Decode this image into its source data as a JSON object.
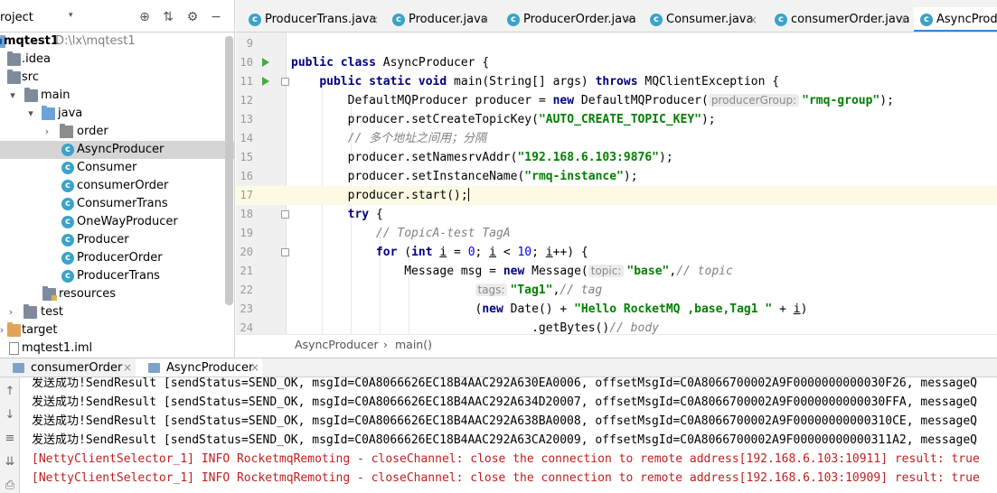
{
  "project": {
    "header_label": "roject",
    "arrow": "▾",
    "icons": [
      "target-icon",
      "collapse-icon",
      "gear-icon",
      "minimize-icon"
    ],
    "tree": [
      {
        "label": "mqtest1",
        "sub": "D:\\lx\\mqtest1",
        "icon": "module-icon",
        "arrow": "▾"
      },
      {
        "label": ".idea",
        "icon": "folder-icon",
        "arrow": ""
      },
      {
        "label": "src",
        "icon": "folder-icon",
        "arrow": ""
      },
      {
        "label": "main",
        "icon": "folder-icon",
        "arrow": "▾"
      },
      {
        "label": "java",
        "icon": "folder-icon",
        "arrow": "▾"
      },
      {
        "label": "order",
        "icon": "package-icon",
        "arrow": "›"
      },
      {
        "label": "AsyncProducer",
        "icon": "class-icon",
        "arrow": ""
      },
      {
        "label": "Consumer",
        "icon": "class-icon",
        "arrow": ""
      },
      {
        "label": "consumerOrder",
        "icon": "class-icon",
        "arrow": ""
      },
      {
        "label": "ConsumerTrans",
        "icon": "class-icon",
        "arrow": ""
      },
      {
        "label": "OneWayProducer",
        "icon": "class-icon",
        "arrow": ""
      },
      {
        "label": "Producer",
        "icon": "class-icon",
        "arrow": ""
      },
      {
        "label": "ProducerOrder",
        "icon": "class-icon",
        "arrow": ""
      },
      {
        "label": "ProducerTrans",
        "icon": "class-icon",
        "arrow": ""
      },
      {
        "label": "resources",
        "icon": "resources-folder-icon",
        "arrow": ""
      },
      {
        "label": "test",
        "icon": "folder-icon",
        "arrow": "›"
      },
      {
        "label": "target",
        "icon": "folder-icon",
        "arrow": "›"
      },
      {
        "label": "mqtest1.iml",
        "icon": "file-icon",
        "arrow": ""
      }
    ]
  },
  "editor_tabs": [
    {
      "label": "ProducerTrans.java",
      "close": "×"
    },
    {
      "label": "Producer.java",
      "close": "×"
    },
    {
      "label": "ProducerOrder.java",
      "close": "×"
    },
    {
      "label": "Consumer.java",
      "close": "×"
    },
    {
      "label": "consumerOrder.java",
      "close": "×"
    },
    {
      "label": "AsyncProdu",
      "close": ""
    }
  ],
  "code": {
    "line_numbers": [
      "9",
      "10",
      "11",
      "12",
      "13",
      "14",
      "15",
      "16",
      "17",
      "18",
      "19",
      "20",
      "21",
      "22",
      "23",
      "24"
    ],
    "l10": {
      "kw1": "public class ",
      "rest": "AsyncProducer {"
    },
    "l11": {
      "kw1": "public static void ",
      "mid": "main(String[] args) ",
      "kw2": "throws ",
      "rest": "MQClientException {"
    },
    "l12": {
      "a": "DefaultMQProducer producer = ",
      "kw": "new ",
      "b": "DefaultMQProducer(",
      "hint": "producerGroup:",
      "str": "\"rmq-group\"",
      "c": ");"
    },
    "l13": {
      "a": "producer.setCreateTopicKey(",
      "str": "\"AUTO_CREATE_TOPIC_KEY\"",
      "c": ");"
    },
    "l14": {
      "cmt": "// 多个地址之间用；分隔"
    },
    "l15": {
      "a": "producer.setNamesrvAddr(",
      "str": "\"192.168.6.103:9876\"",
      "c": ");"
    },
    "l16": {
      "a": "producer.setInstanceName(",
      "str": "\"rmq-instance\"",
      "c": ");"
    },
    "l17": {
      "a": "producer.start();"
    },
    "l18": {
      "kw": "try ",
      "c": "{"
    },
    "l19": {
      "cmt": "// TopicA-test TagA"
    },
    "l20": {
      "kw": "for ",
      "a": "(",
      "kw2": "int ",
      "v1": "i",
      "b": " = ",
      "n1": "0",
      "c": "; ",
      "v2": "i",
      "d": " < ",
      "n2": "10",
      "e": "; ",
      "v3": "i",
      "f": "++) {"
    },
    "l21": {
      "a": "Message msg = ",
      "kw": "new ",
      "b": "Message(",
      "hint": "topic:",
      "str": "\"base\"",
      "c": ",",
      "cmt": "// topic"
    },
    "l22": {
      "hint": "tags:",
      "str": "\"Tag1\"",
      "c": ",",
      "cmt": "// tag"
    },
    "l23": {
      "a": "(",
      "kw": "new ",
      "b": "Date() + ",
      "str": "\"Hello RocketMQ ,base,Tag1 \"",
      "c": " + ",
      "v": "i",
      "d": ")"
    },
    "l24": {
      "a": ".getBytes()",
      "cmt": "// body"
    }
  },
  "breadcrumb": [
    "AsyncProducer",
    "›",
    "main()"
  ],
  "run": {
    "tabs": [
      {
        "label": "consumerOrder",
        "close": "×"
      },
      {
        "label": "AsyncProducer",
        "close": "×"
      }
    ],
    "tools": [
      "arrow-up-icon",
      "arrow-down-icon",
      "soft-wrap-icon",
      "scroll-to-end-icon",
      "print-icon"
    ],
    "lines": [
      "发送成功!SendResult [sendStatus=SEND_OK, msgId=C0A8066626EC18B4AAC292A630EA0006, offsetMsgId=C0A8066700002A9F0000000000030F26, messageQ",
      "发送成功!SendResult [sendStatus=SEND_OK, msgId=C0A8066626EC18B4AAC292A634D20007, offsetMsgId=C0A8066700002A9F0000000000030FFA, messageQ",
      "发送成功!SendResult [sendStatus=SEND_OK, msgId=C0A8066626EC18B4AAC292A638BA0008, offsetMsgId=C0A8066700002A9F00000000000310CE, messageQ",
      "发送成功!SendResult [sendStatus=SEND_OK, msgId=C0A8066626EC18B4AAC292A63CA20009, offsetMsgId=C0A8066700002A9F00000000000311A2, messageQ",
      "[NettyClientSelector_1] INFO RocketmqRemoting - closeChannel: close the connection to remote address[192.168.6.103:10911] result: true",
      "[NettyClientSelector_1] INFO RocketmqRemoting - closeChannel: close the connection to remote address[192.168.6.103:10909] result: true"
    ]
  }
}
